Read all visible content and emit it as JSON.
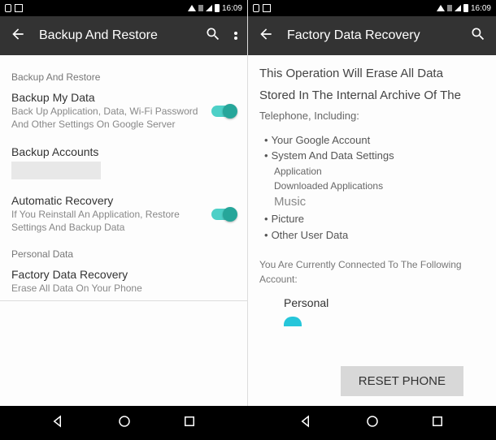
{
  "statusbar": {
    "time": "16:09"
  },
  "left": {
    "appbar": {
      "title": "Backup And Restore"
    },
    "section1": "Backup And Restore",
    "backup_data": {
      "title": "Backup My Data",
      "sub": "Back Up Application, Data, Wi-Fi Password And Other Settings On Google Server"
    },
    "backup_accounts": {
      "title": "Backup Accounts"
    },
    "auto_recovery": {
      "title": "Automatic Recovery",
      "sub": "If You Reinstall An Application, Restore Settings And Backup Data"
    },
    "section2": "Personal Data",
    "factory": {
      "title": "Factory Data Recovery",
      "sub": "Erase All Data On Your Phone"
    }
  },
  "right": {
    "appbar": {
      "title": "Factory Data Recovery"
    },
    "intro1": "This Operation Will Erase All Data",
    "intro2": "Stored In The Internal Archive Of The",
    "intro3": "Telephone, Including:",
    "items": {
      "google": "Your Google Account",
      "system": "System And Data Settings",
      "application": "Application",
      "downloaded": "Downloaded Applications",
      "music": "Music",
      "picture": "Picture",
      "other": "Other User Data"
    },
    "connected": "You Are Currently Connected To The Following Account:",
    "account": "Personal",
    "reset": "RESET PHONE"
  }
}
